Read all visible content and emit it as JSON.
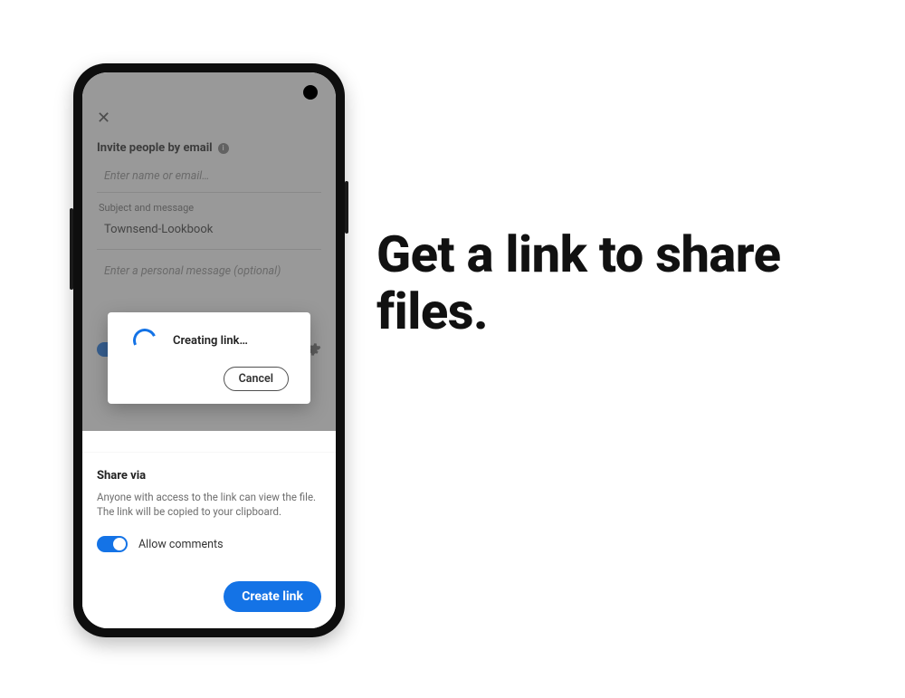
{
  "marketing": {
    "headline": "Get a link to share files."
  },
  "invite": {
    "close_glyph": "✕",
    "title": "Invite people by email",
    "info_glyph": "i",
    "recipient_placeholder": "Enter name or email…",
    "subject_section_label": "Subject and message",
    "subject_value": "Townsend-Lookbook",
    "message_placeholder": "Enter a personal message (optional)"
  },
  "modal": {
    "status": "Creating link…",
    "cancel": "Cancel"
  },
  "sheet": {
    "title": "Share via",
    "description": "Anyone with access to the link can view the file. The link will be copied to your clipboard.",
    "allow_comments_label": "Allow comments",
    "allow_comments_on": true,
    "cta": "Create link"
  },
  "colors": {
    "accent": "#1473e6"
  }
}
